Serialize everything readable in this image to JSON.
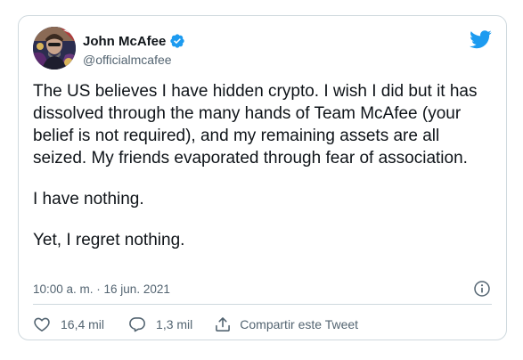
{
  "tweet": {
    "author": {
      "display_name": "John McAfee",
      "handle": "@officialmcafee",
      "verified": true
    },
    "paragraphs": [
      "The US believes I have hidden crypto. I wish I did but it has dissolved through the many hands of Team McAfee (your belief is not required), and my remaining assets are all seized. My friends evaporated through fear of association.",
      "I have nothing.",
      "Yet, I regret nothing."
    ],
    "timestamp": "10:00 a. m. · 16 jun. 2021",
    "actions": {
      "likes": "16,4 mil",
      "replies": "1,3 mil",
      "share_label": "Compartir este Tweet"
    }
  },
  "icons": {
    "brand": "twitter-bird-icon",
    "verified": "verified-badge-icon",
    "info": "info-icon",
    "like": "heart-icon",
    "reply": "reply-bubble-icon",
    "share": "share-icon"
  },
  "colors": {
    "brand_blue": "#1d9bf0",
    "text_primary": "#0f1419",
    "text_secondary": "#536471",
    "border": "#cfd9de"
  }
}
